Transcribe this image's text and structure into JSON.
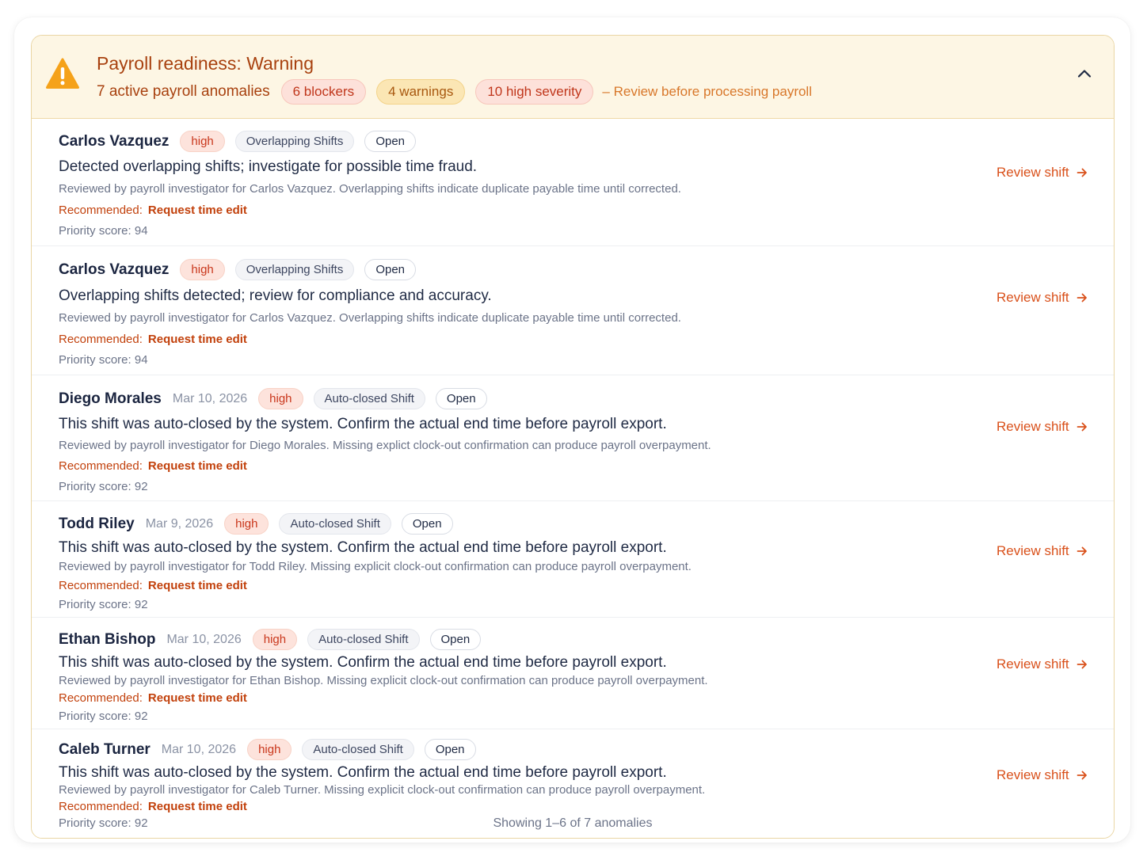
{
  "banner": {
    "title": "Payroll readiness: Warning",
    "count": "7 active payroll anomalies",
    "blockers": "6 blockers",
    "warnings": "4 warnings",
    "high_severity": "10 high severity",
    "note": "– Review before processing payroll"
  },
  "anomalies": [
    {
      "employee": "Carlos Vazquez",
      "date": "",
      "severity": "high",
      "type": "Overlapping Shifts",
      "status": "Open",
      "description": "Detected overlapping shifts; investigate for possible time fraud.",
      "detail": "Reviewed by payroll investigator for Carlos Vazquez. Overlapping shifts indicate duplicate payable time until corrected.",
      "rec_label": "Recommended:",
      "rec_action": "Request time edit",
      "score": "Priority score: 94",
      "action": "Review shift"
    },
    {
      "employee": "Carlos Vazquez",
      "date": "",
      "severity": "high",
      "type": "Overlapping Shifts",
      "status": "Open",
      "description": "Overlapping shifts detected; review for compliance and accuracy.",
      "detail": "Reviewed by payroll investigator for Carlos Vazquez. Overlapping shifts indicate duplicate payable time until corrected.",
      "rec_label": "Recommended:",
      "rec_action": "Request time edit",
      "score": "Priority score: 94",
      "action": "Review shift"
    },
    {
      "employee": "Diego Morales",
      "date": "Mar 10, 2026",
      "severity": "high",
      "type": "Auto-closed Shift",
      "status": "Open",
      "description": "This shift was auto-closed by the system. Confirm the actual end time before payroll export.",
      "detail": "Reviewed by payroll investigator for Diego Morales. Missing explict clock-out confirmation can produce payroll overpayment.",
      "rec_label": "Recommended:",
      "rec_action": "Request time edit",
      "score": "Priority score: 92",
      "action": "Review shift"
    },
    {
      "employee": "Todd Riley",
      "date": "Mar 9, 2026",
      "severity": "high",
      "type": "Auto-closed Shift",
      "status": "Open",
      "description": "This shift was auto-closed by the system. Confirm the actual end time before payroll export.",
      "detail": "Reviewed by payroll investigator for Todd Riley. Missing explicit clock-out confirmation can produce payroll overpayment.",
      "rec_label": "Recommended:",
      "rec_action": "Request time edit",
      "score": "Priority score: 92",
      "action": "Review shift"
    },
    {
      "employee": "Ethan Bishop",
      "date": "Mar 10, 2026",
      "severity": "high",
      "type": "Auto-closed Shift",
      "status": "Open",
      "description": "This shift was auto-closed by the system. Confirm the actual end time before payroll export.",
      "detail": "Reviewed by payroll investigator for Ethan Bishop. Missing explicit clock-out confirmation can produce payroll overpayment.",
      "rec_label": "Recommended:",
      "rec_action": "Request time edit",
      "score": "Priority score: 92",
      "action": "Review shift"
    },
    {
      "employee": "Caleb Turner",
      "date": "Mar 10, 2026",
      "severity": "high",
      "type": "Auto-closed Shift",
      "status": "Open",
      "description": "This shift was auto-closed by the system. Confirm the actual end time before payroll export.",
      "detail": "Reviewed by payroll investigator for Caleb Turner. Missing explicit clock-out confirmation can produce payroll overpayment.",
      "rec_label": "Recommended:",
      "rec_action": "Request time edit",
      "score": "Priority score: 92",
      "action": "Review shift"
    }
  ],
  "footer": "Showing 1–6 of 7 anomalies",
  "colors": {
    "accent": "#d9501a",
    "warning_bg": "#fdf6e4",
    "warning_text": "#a8410f",
    "severity_high_bg": "#fde3dc"
  },
  "icons": {
    "banner": "warning-triangle-icon",
    "collapse": "chevron-up-icon",
    "review": "arrow-right-icon"
  }
}
